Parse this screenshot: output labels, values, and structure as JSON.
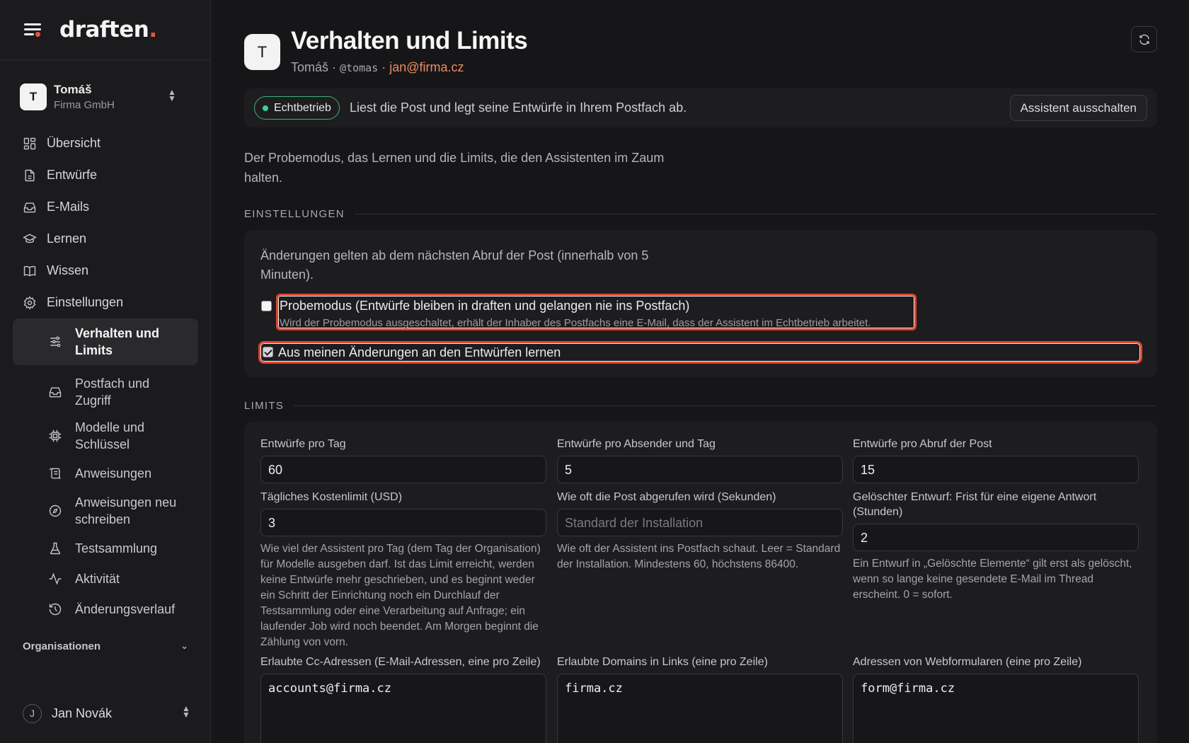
{
  "brand": {
    "logo_text": "draften",
    "logo_dot": ".",
    "accent": "#e8553f"
  },
  "tenant": {
    "avatar": "T",
    "name": "Tomáš",
    "org": "Firma GmbH"
  },
  "nav": {
    "items": [
      {
        "label": "Übersicht",
        "icon": "dashboard-icon"
      },
      {
        "label": "Entwürfe",
        "icon": "document-icon"
      },
      {
        "label": "E-Mails",
        "icon": "inbox-icon"
      },
      {
        "label": "Lernen",
        "icon": "graduation-cap-icon"
      },
      {
        "label": "Wissen",
        "icon": "book-icon"
      },
      {
        "label": "Einstellungen",
        "icon": "gear-icon"
      }
    ],
    "sub_items": [
      {
        "label": "Verhalten und Limits",
        "icon": "sliders-icon"
      },
      {
        "label": "Postfach und Zugriff",
        "icon": "inbox-icon"
      },
      {
        "label": "Modelle und Schlüssel",
        "icon": "chip-icon"
      },
      {
        "label": "Anweisungen",
        "icon": "scroll-icon"
      },
      {
        "label": "Anweisungen neu schreiben",
        "icon": "compass-icon"
      },
      {
        "label": "Testsammlung",
        "icon": "flask-icon"
      },
      {
        "label": "Aktivität",
        "icon": "activity-icon"
      },
      {
        "label": "Änderungsverlauf",
        "icon": "history-icon"
      }
    ],
    "org_section": "Organisationen"
  },
  "user": {
    "avatar": "J",
    "name": "Jan Novák"
  },
  "header": {
    "avatar": "T",
    "title": "Verhalten und Limits",
    "owner": "Tomáš",
    "sep": "·",
    "handle": "@tomas",
    "email": "jan@firma.cz"
  },
  "status": {
    "badge": "Echtbetrieb",
    "text": "Liest die Post und legt seine Entwürfe in Ihrem Postfach ab.",
    "button": "Assistent ausschalten",
    "color": "#3fcf8e"
  },
  "intro": "Der Probemodus, das Lernen und die Limits, die den Assistenten im Zaum halten.",
  "settings": {
    "heading": "EINSTELLUNGEN",
    "note": "Änderungen gelten ab dem nächsten Abruf der Post (innerhalb von 5 Minuten).",
    "trial_label": "Probemodus (Entwürfe bleiben in draften und gelangen nie ins Postfach)",
    "trial_hint": "Wird der Probemodus ausgeschaltet, erhält der Inhaber des Postfachs eine E-Mail, dass der Assistent im Echtbetrieb arbeitet.",
    "trial_checked": false,
    "learn_label": "Aus meinen Änderungen an den Entwürfen lernen",
    "learn_checked": true
  },
  "limits": {
    "heading": "LIMITS",
    "drafts_per_day": {
      "label": "Entwürfe pro Tag",
      "value": "60"
    },
    "drafts_per_sender": {
      "label": "Entwürfe pro Absender und Tag",
      "value": "5"
    },
    "drafts_per_fetch": {
      "label": "Entwürfe pro Abruf der Post",
      "value": "15"
    },
    "cost_limit": {
      "label": "Tägliches Kostenlimit (USD)",
      "value": "3",
      "help": "Wie viel der Assistent pro Tag (dem Tag der Organisation) für Modelle ausgeben darf. Ist das Limit erreicht, werden keine Entwürfe mehr geschrieben, und es beginnt weder ein Schritt der Einrichtung noch ein Durchlauf der Testsammlung oder eine Verarbeitung auf Anfrage; ein laufender Job wird noch beendet. Am Morgen beginnt die Zählung von vorn."
    },
    "poll_interval": {
      "label": "Wie oft die Post abgerufen wird (Sekunden)",
      "placeholder": "Standard der Installation",
      "help": "Wie oft der Assistent ins Postfach schaut. Leer = Standard der Installation. Mindestens 60, höchstens 86400."
    },
    "deleted_grace": {
      "label": "Gelöschter Entwurf: Frist für eine eigene Antwort (Stunden)",
      "value": "2",
      "help": "Ein Entwurf in „Gelöschte Elemente“ gilt erst als gelöscht, wenn so lange keine gesendete E-Mail im Thread erscheint. 0 = sofort."
    },
    "cc_addresses": {
      "label": "Erlaubte Cc-Adressen (E-Mail-Adressen, eine pro Zeile)",
      "value": "accounts@firma.cz"
    },
    "link_domains": {
      "label": "Erlaubte Domains in Links (eine pro Zeile)",
      "value": "firma.cz"
    },
    "webform_addresses": {
      "label": "Adressen von Webformularen (eine pro Zeile)",
      "value": "form@firma.cz"
    }
  }
}
